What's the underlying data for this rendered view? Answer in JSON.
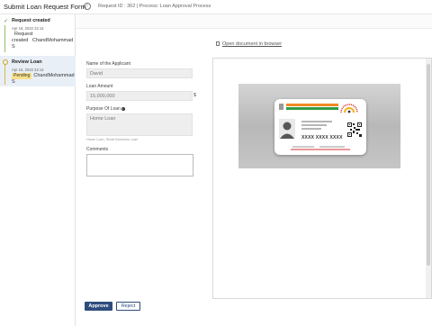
{
  "header": {
    "title": "Submit Loan Request Form",
    "meta": "Request ID : 362 | Process: Loan Approval Process"
  },
  "timeline": [
    {
      "title": "Request created",
      "date": "Apr 16, 2022 22:14",
      "text_lines": [
        "Request",
        "created",
        "ChandMohammad",
        "S"
      ],
      "state": "completed"
    },
    {
      "title": "Review Loan",
      "date": "Apr 16, 2022 22:14",
      "badge": "Pending",
      "assignee": "ChandMohammad",
      "assignee_suffix": "S",
      "state": "pending"
    }
  ],
  "form": {
    "applicant": {
      "label": "Name of the Applicant",
      "value": "David"
    },
    "amount": {
      "label": "Loan Amount",
      "value": "15,000,000",
      "currency": "$"
    },
    "purpose": {
      "label": "Purpose Of Loan",
      "value": "Home Loan",
      "hint": "Home Loan, Small Business Loan"
    },
    "comments": {
      "label": "Comments",
      "value": ""
    }
  },
  "document": {
    "open_link": "Open document in browser",
    "card_number": "XXXX XXXX XXXX"
  },
  "actions": {
    "approve": "Approve",
    "reject": "Reject"
  },
  "colors": {
    "primary": "#2d4c7c",
    "pending_badge": "#f8e08a",
    "selected_step_bg": "#e9eff6",
    "completed_rail": "#8fbf5f"
  }
}
